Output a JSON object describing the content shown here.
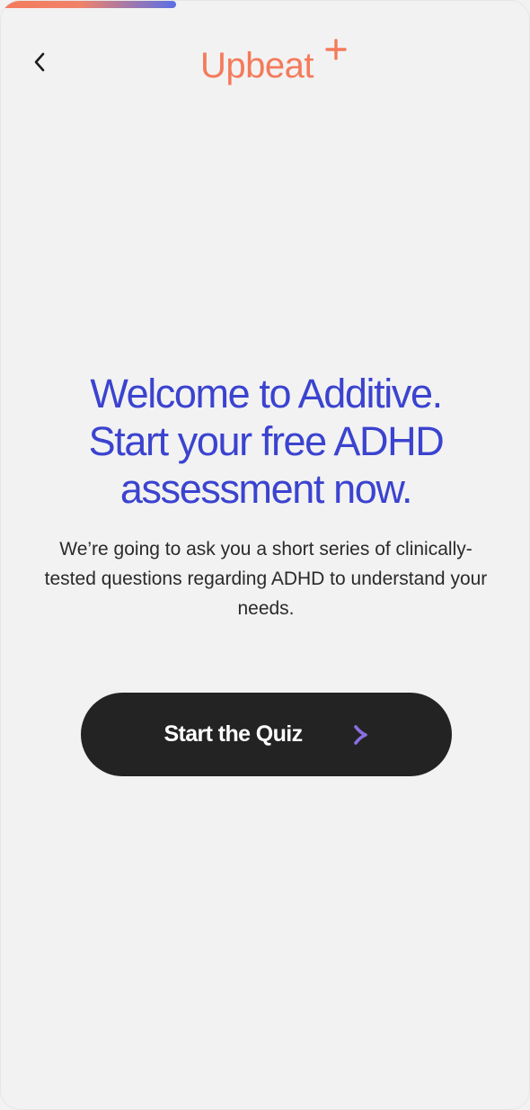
{
  "header": {
    "progress": 0.33,
    "logo_text": "Upbeat",
    "back_icon": "chevron-left-icon",
    "logo_icon": "plus-icon"
  },
  "hero": {
    "headline_line1": "Welcome to Additive.",
    "headline_line2": "Start your free ADHD",
    "headline_line3": "assessment now.",
    "subtext": "We’re going to ask you a short series of clinically-tested questions regarding ADHD to understand your needs."
  },
  "cta": {
    "label": "Start the Quiz",
    "icon": "arrow-right-icon"
  },
  "colors": {
    "brand_orange": "#f47a5c",
    "headline_blue": "#3b43cf",
    "button_dark": "#232323",
    "background": "#f2f2f2",
    "arrow_purple": "#8a6fe0"
  }
}
